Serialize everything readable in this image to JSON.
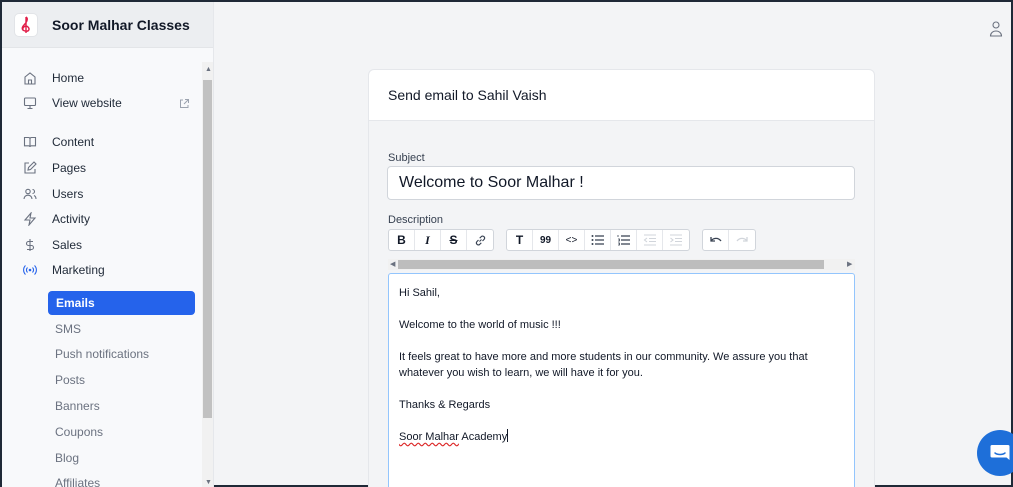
{
  "app": {
    "title": "Soor Malhar Classes"
  },
  "sidebar": {
    "primary": [
      {
        "label": "Home",
        "icon": "home-icon"
      },
      {
        "label": "View website",
        "icon": "monitor-icon",
        "trailing_icon": "external-link-icon"
      }
    ],
    "sections": [
      {
        "label": "Content",
        "icon": "book-icon"
      },
      {
        "label": "Pages",
        "icon": "edit-icon"
      },
      {
        "label": "Users",
        "icon": "users-icon"
      },
      {
        "label": "Activity",
        "icon": "activity-icon"
      },
      {
        "label": "Sales",
        "icon": "dollar-icon"
      },
      {
        "label": "Marketing",
        "icon": "broadcast-icon"
      }
    ],
    "marketing_sub": [
      {
        "label": "Emails",
        "active": true
      },
      {
        "label": "SMS"
      },
      {
        "label": "Push notifications"
      },
      {
        "label": "Posts"
      },
      {
        "label": "Banners"
      },
      {
        "label": "Coupons"
      },
      {
        "label": "Blog"
      },
      {
        "label": "Affiliates"
      }
    ]
  },
  "email": {
    "header": "Send email to Sahil Vaish",
    "subject_label": "Subject",
    "subject_value": "Welcome to Soor Malhar !",
    "description_label": "Description",
    "toolbar": {
      "bold": "B",
      "italic": "I",
      "strike": "S",
      "heading": "T",
      "quote": "99",
      "code": "<>"
    },
    "body": {
      "greeting": "Hi Sahil,",
      "line1": "Welcome to the world of music !!!",
      "line2": "It feels great to have more and more students in our community. We assure you that whatever you wish to learn, we will have it for you.",
      "closing": "Thanks & Regards",
      "signature_word": "Soor Malhar",
      "signature_rest": " Academy"
    }
  },
  "colors": {
    "accent": "#2563eb",
    "chat": "#1e6fd9",
    "brand_logo": "#e11d48"
  }
}
